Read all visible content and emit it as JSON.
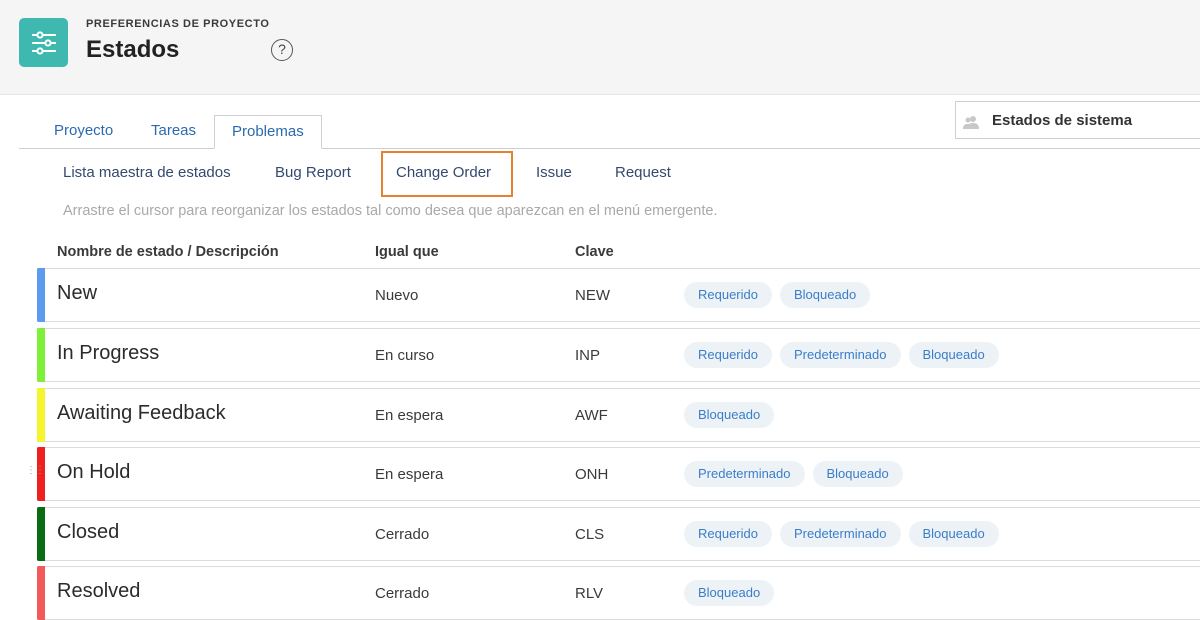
{
  "header": {
    "eyebrow": "PREFERENCIAS DE PROYECTO",
    "title": "Estados",
    "help_label": "?",
    "icon": "sliders-icon",
    "icon_color": "#3fb8b0"
  },
  "tabs": [
    {
      "label": "Proyecto",
      "active": false
    },
    {
      "label": "Tareas",
      "active": false
    },
    {
      "label": "Problemas",
      "active": true
    }
  ],
  "system_select": {
    "label": "Estados de sistema",
    "icon": "people-icon"
  },
  "subtabs": [
    {
      "label": "Lista maestra de estados",
      "selected": false
    },
    {
      "label": "Bug Report",
      "selected": false
    },
    {
      "label": "Change Order",
      "selected": true
    },
    {
      "label": "Issue",
      "selected": false
    },
    {
      "label": "Request",
      "selected": false
    }
  ],
  "hint": "Arrastre el cursor para reorganizar los estados tal como desea que aparezcan en el menú emergente.",
  "columns": {
    "name": "Nombre de estado / Descripción",
    "equal": "Igual que",
    "key": "Clave"
  },
  "rows": [
    {
      "name": "New",
      "equal": "Nuevo",
      "key": "NEW",
      "color": "#5b9bf0",
      "tags": [
        "Requerido",
        "Bloqueado"
      ]
    },
    {
      "name": "In Progress",
      "equal": "En curso",
      "key": "INP",
      "color": "#7ef03a",
      "tags": [
        "Requerido",
        "Predeterminado",
        "Bloqueado"
      ]
    },
    {
      "name": "Awaiting Feedback",
      "equal": "En espera",
      "key": "AWF",
      "color": "#f5f52e",
      "tags": [
        "Bloqueado"
      ]
    },
    {
      "name": "On Hold",
      "equal": "En espera",
      "key": "ONH",
      "color": "#ee2020",
      "tags": [
        "Predeterminado",
        "Bloqueado"
      ]
    },
    {
      "name": "Closed",
      "equal": "Cerrado",
      "key": "CLS",
      "color": "#0b6b13",
      "tags": [
        "Requerido",
        "Predeterminado",
        "Bloqueado"
      ]
    },
    {
      "name": "Resolved",
      "equal": "Cerrado",
      "key": "RLV",
      "color": "#f25a5a",
      "tags": [
        "Bloqueado"
      ]
    }
  ],
  "accent_color": "#e5822f"
}
